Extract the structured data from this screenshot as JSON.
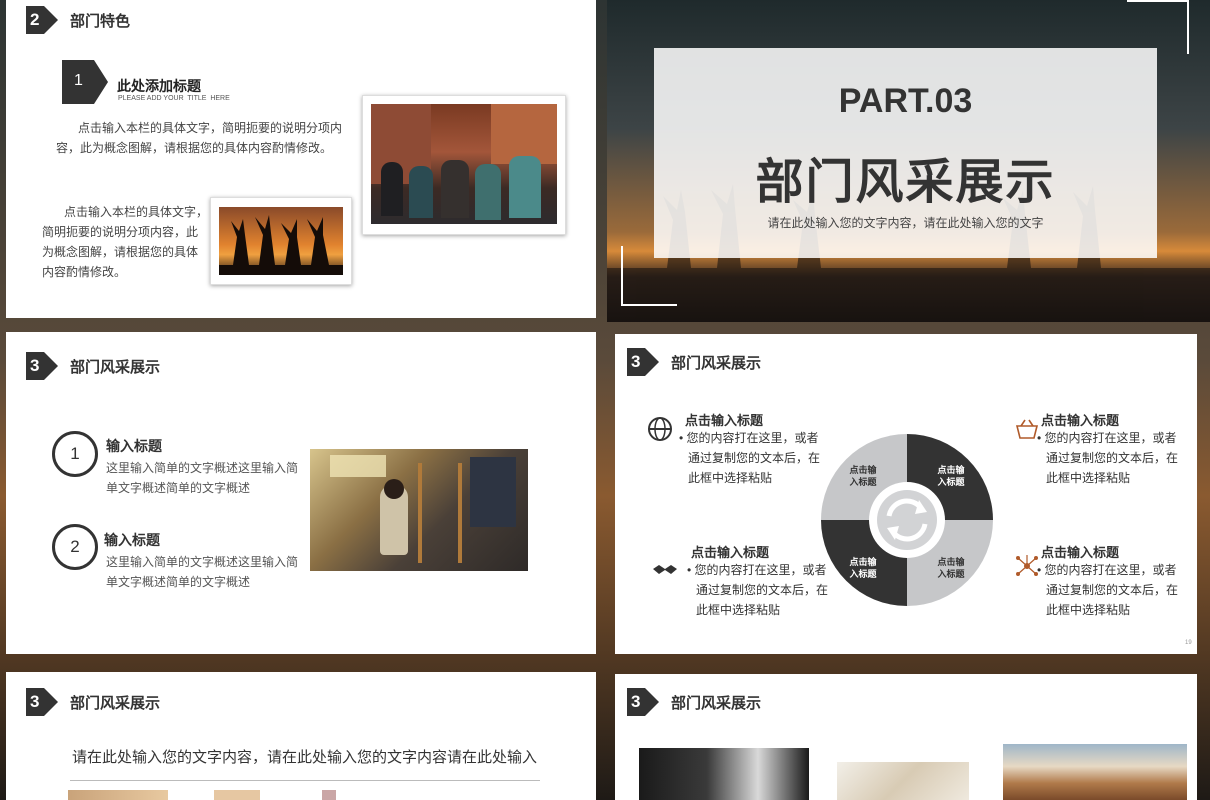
{
  "slide1": {
    "header_num": "2",
    "header_title": "部门特色",
    "item_num": "1",
    "item_title": "此处添加标题",
    "item_subtitle": "PLEASE ADD YOUR  TITLE  HERE",
    "para1_line1": "点击输入本栏的具体文字，简明扼要的说明分项内",
    "para1_line2": "容，此为概念图解，请根据您的具体内容酌情修改。",
    "para2_lines": [
      "点击输入本栏的具体文字，",
      "简明扼要的说明分项内容，此",
      "为概念图解，请根据您的具体",
      "内容酌情修改。"
    ]
  },
  "slide2": {
    "part": "PART.03",
    "title": "部门风采展示",
    "subtitle": "请在此处输入您的文字内容，请在此处输入您的文字"
  },
  "slide3": {
    "header_num": "3",
    "header_title": "部门风采展示",
    "items": [
      {
        "num": "1",
        "title": "输入标题",
        "line1": "这里输入简单的文字概述这里输入简",
        "line2": "单文字概述简单的文字概述"
      },
      {
        "num": "2",
        "title": "输入标题",
        "line1": "这里输入简单的文字概述这里输入简",
        "line2": "单文字概述简单的文字概述"
      }
    ]
  },
  "slide4": {
    "header_num": "3",
    "header_title": "部门风采展示",
    "blocks": [
      {
        "title": "点击输入标题",
        "line1": "• 您的内容打在这里，或者",
        "line2": "通过复制您的文本后，在",
        "line3": "此框中选择粘贴",
        "icon": "globe-icon"
      },
      {
        "title": "点击输入标题",
        "line1": "• 您的内容打在这里，或者",
        "line2": "通过复制您的文本后，在",
        "line3": "此框中选择粘贴",
        "icon": "basket-icon"
      },
      {
        "title": "点击输入标题",
        "line1": "• 您的内容打在这里，或者",
        "line2": "通过复制您的文本后，在",
        "line3": "此框中选择粘贴",
        "icon": "handshake-icon"
      },
      {
        "title": "点击输入标题",
        "line1": "• 您的内容打在这里，或者",
        "line2": "通过复制您的文本后，在",
        "line3": "此框中选择粘贴",
        "icon": "network-icon"
      }
    ],
    "segments": [
      "点击输\n入标题",
      "点击输\n入标题",
      "点击输\n入标题",
      "点击输\n入标题"
    ],
    "page_num": "19"
  },
  "slide5": {
    "header_num": "3",
    "header_title": "部门风采展示",
    "body": "请在此处输入您的文字内容，请在此处输入您的文字内容请在此处输入"
  },
  "slide6": {
    "header_num": "3",
    "header_title": "部门风采展示"
  },
  "colors": {
    "dark": "#333333",
    "gray": "#c6c7c9",
    "accent": "#b05a2a"
  }
}
